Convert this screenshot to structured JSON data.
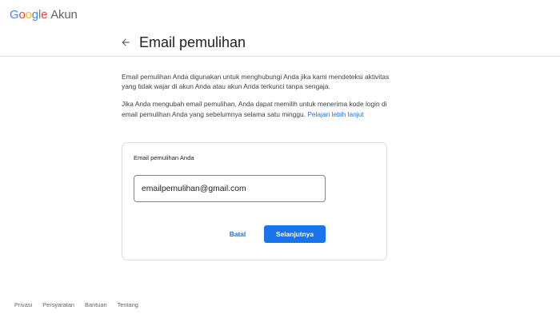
{
  "brand": {
    "logo_letters": [
      "G",
      "o",
      "o",
      "g",
      "l",
      "e"
    ],
    "product": "Akun"
  },
  "header": {
    "back_icon": "arrow-left-icon",
    "title": "Email pemulihan"
  },
  "main": {
    "paragraph_1": "Email pemulihan Anda digunakan untuk menghubungi Anda jika kami mendeteksi aktivitas yang tidak wajar di akun Anda atau akun Anda terkunci tanpa sengaja.",
    "paragraph_2": "Jika Anda mengubah email pemulihan, Anda dapat memilih untuk menerima kode login di email pemulihan Anda yang sebelumnya selama satu minggu.",
    "learn_more_link": "Pelajari lebih lanjut"
  },
  "card": {
    "label": "Email pemulihan Anda",
    "email_value": "emailpemulihan@gmail.com",
    "cancel_label": "Batal",
    "next_label": "Selanjutnya"
  },
  "footer": {
    "links": [
      "Privasi",
      "Persyaratan",
      "Bantuan",
      "Tentang"
    ]
  },
  "colors": {
    "accent": "#1a73e8",
    "google_blue": "#4285f4",
    "google_red": "#ea4335",
    "google_yellow": "#fbbc05",
    "google_green": "#34a853"
  }
}
